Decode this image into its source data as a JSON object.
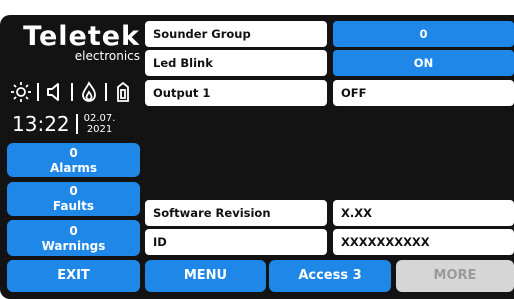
{
  "brand": {
    "logo": "Teletek",
    "sub": "electronics"
  },
  "status_icons": [
    "sun-icon",
    "speaker-icon",
    "fire-icon",
    "output-icon"
  ],
  "clock": {
    "time": "13:22",
    "date_day": "02.07.",
    "date_year": "2021"
  },
  "status": {
    "alarms": {
      "count": "0",
      "label": "Alarms"
    },
    "faults": {
      "count": "0",
      "label": "Faults"
    },
    "warnings": {
      "count": "0",
      "label": "Warnings"
    }
  },
  "settings": [
    {
      "label": "Sounder Group",
      "value": "0"
    },
    {
      "label": "Led Blink",
      "value": "ON"
    },
    {
      "label": "Output 1",
      "value": "OFF"
    }
  ],
  "info": [
    {
      "label": "Software Revision",
      "value": "X.XX"
    },
    {
      "label": "ID",
      "value": "XXXXXXXXXX"
    }
  ],
  "footer": {
    "exit": "EXIT",
    "menu": "MENU",
    "access": "Access 3",
    "more": "MORE"
  },
  "colors": {
    "accent": "#1f87e8",
    "panel": "#131313",
    "disabled": "#d6d6d6"
  }
}
